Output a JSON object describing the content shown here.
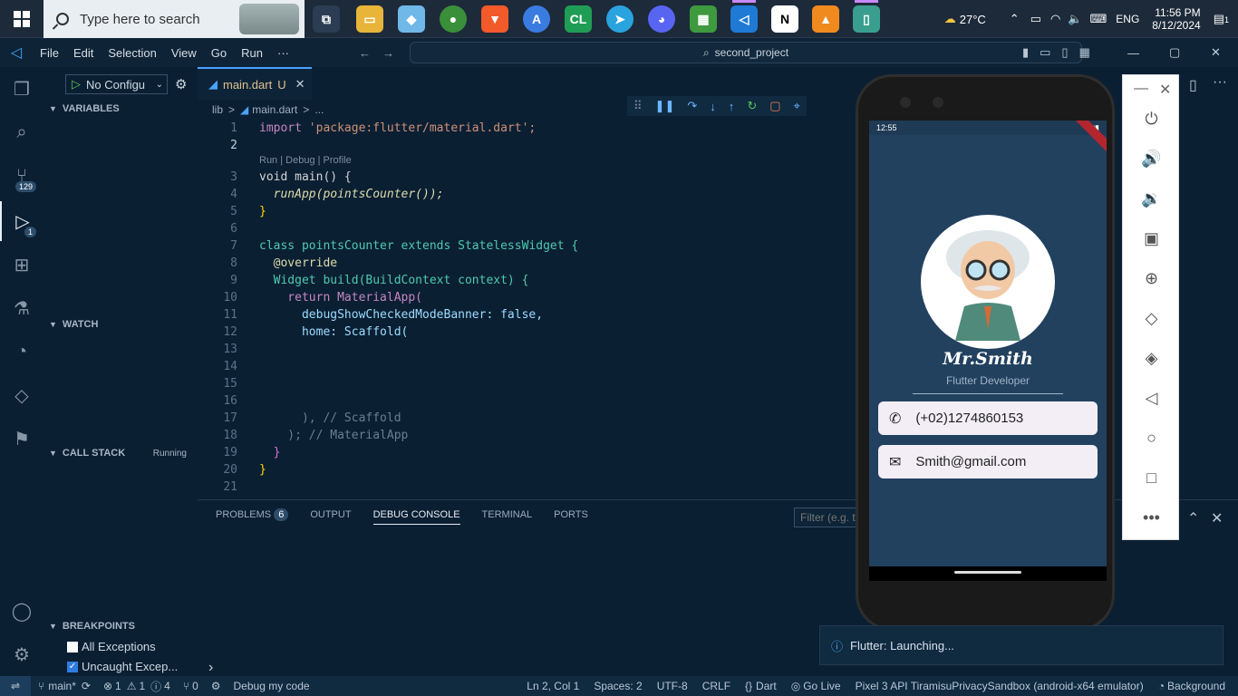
{
  "taskbar": {
    "search_placeholder": "Type here to search",
    "weather": "27°C",
    "lang": "ENG",
    "time": "11:56 PM",
    "date": "8/12/2024",
    "notif": "1"
  },
  "titlebar": {
    "menus": [
      "File",
      "Edit",
      "Selection",
      "View",
      "Go",
      "Run",
      "···"
    ],
    "command_center": "second_project"
  },
  "debug": {
    "config": "No Configu",
    "badge_scm": "129",
    "badge_debug": "1"
  },
  "sidebar": {
    "variables": "VARIABLES",
    "watch": "WATCH",
    "call_stack": "CALL STACK",
    "call_stack_status": "Running",
    "breakpoints": "BREAKPOINTS",
    "bp_all": "All Exceptions",
    "bp_uncaught": "Uncaught Excep..."
  },
  "editor": {
    "tab_label": "main.dart",
    "tab_status": "U",
    "crumbs": [
      "lib",
      ">",
      "main.dart",
      ">",
      "..."
    ],
    "codelens": "Run | Debug | Profile"
  },
  "code_lines": [
    {
      "n": "1",
      "t": "import 'package:flutter/material.dart';"
    },
    {
      "n": "2",
      "t": ""
    },
    {
      "n": "3",
      "t": "void main() {"
    },
    {
      "n": "4",
      "t": "  runApp(pointsCounter());"
    },
    {
      "n": "5",
      "t": "}"
    },
    {
      "n": "6",
      "t": ""
    },
    {
      "n": "7",
      "t": "class pointsCounter extends StatelessWidget {"
    },
    {
      "n": "8",
      "t": "  @override"
    },
    {
      "n": "9",
      "t": "  Widget build(BuildContext context) {"
    },
    {
      "n": "10",
      "t": "    return MaterialApp("
    },
    {
      "n": "11",
      "t": "      debugShowCheckedModeBanner: false,"
    },
    {
      "n": "12",
      "t": "      home: Scaffold("
    },
    {
      "n": "13",
      "t": ""
    },
    {
      "n": "14",
      "t": ""
    },
    {
      "n": "15",
      "t": ""
    },
    {
      "n": "16",
      "t": ""
    },
    {
      "n": "17",
      "t": "      ), // Scaffold"
    },
    {
      "n": "18",
      "t": "    ); // MaterialApp"
    },
    {
      "n": "19",
      "t": "  }"
    },
    {
      "n": "20",
      "t": "}"
    },
    {
      "n": "21",
      "t": ""
    }
  ],
  "panel": {
    "tabs": [
      "PROBLEMS",
      "OUTPUT",
      "DEBUG CONSOLE",
      "TERMINAL",
      "PORTS"
    ],
    "problems_count": "6",
    "filter_placeholder": "Filter (e.g. t"
  },
  "phone": {
    "time": "12:55",
    "name": "Mr.Smith",
    "title": "Flutter Developer",
    "phone": "(+02)1274860153",
    "email": "Smith@gmail.com"
  },
  "toast": "Flutter: Launching...",
  "status": {
    "branch": "main*",
    "errors": "1",
    "warnings": "1",
    "infos": "4",
    "ports": "0",
    "debug": "Debug my code",
    "pos": "Ln 2, Col 1",
    "spaces": "Spaces: 2",
    "enc": "UTF-8",
    "eol": "CRLF",
    "lang": "Dart",
    "golive": "Go Live",
    "device": "Pixel 3 API TiramisuPrivacySandbox (android-x64 emulator)",
    "bg": "Background"
  }
}
